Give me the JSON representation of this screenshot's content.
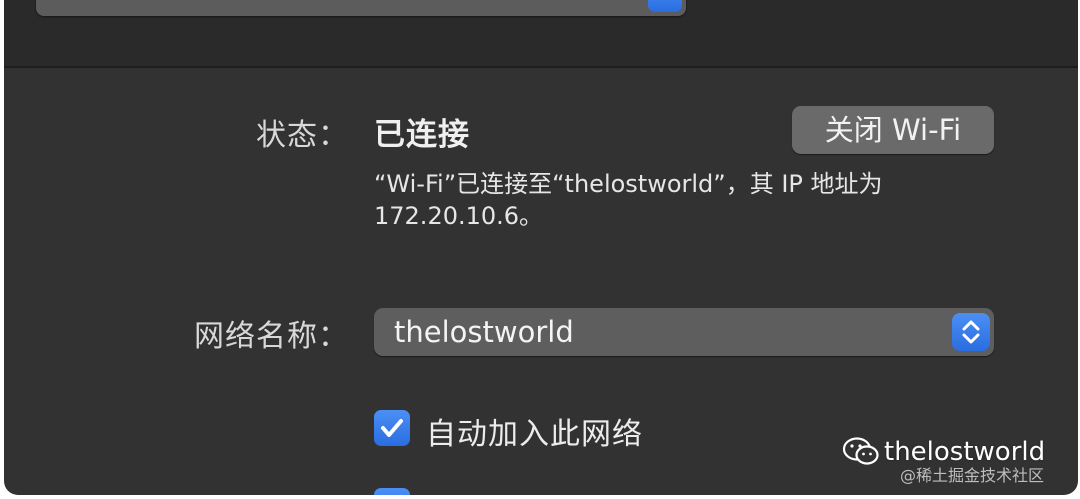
{
  "status": {
    "label": "状态：",
    "value": "已连接",
    "turn_off_button": "关闭 Wi-Fi",
    "description_line1": "“Wi-Fi”已连接至“thelostworld”，其 IP 地址为",
    "description_line2": "172.20.10.6。"
  },
  "network_name": {
    "label": "网络名称：",
    "value": "thelostworld",
    "stepper_icon": "up-down-chevron-icon"
  },
  "auto_join": {
    "label": "自动加入此网络",
    "checked": true
  },
  "watermark": {
    "title": "thelostworld",
    "subtitle": "@稀土掘金技术社区",
    "icon": "wechat-icon"
  },
  "colors": {
    "panel_background": "#323232",
    "accent_blue": "#2f7bf0",
    "button_gray": "#6a6a6a"
  }
}
